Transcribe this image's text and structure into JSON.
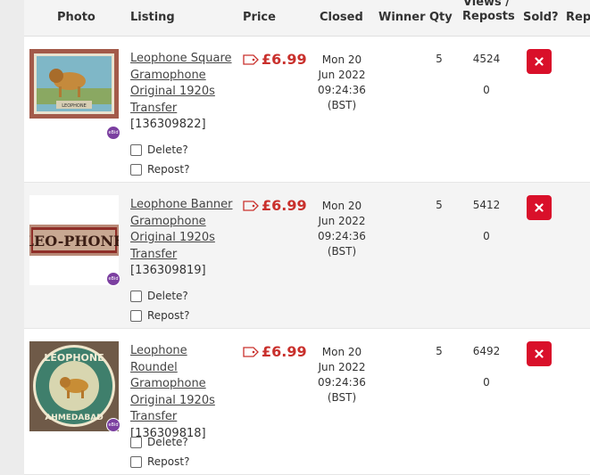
{
  "columns": {
    "photo": "Photo",
    "listing": "Listing",
    "price": "Price",
    "closed": "Closed",
    "winner": "Winner",
    "qty": "Qty",
    "views": "Views /",
    "reposts": "Reposts",
    "sold": "Sold?",
    "repost": "Repo"
  },
  "icons": {
    "price": "price-tag-icon",
    "sold": "close-x-icon",
    "badge": "ebid-badge-icon"
  },
  "colors": {
    "price": "#c9302c",
    "sold_button": "#d9102a",
    "badge": "#7b3fa0"
  },
  "rows": [
    {
      "title": "Leophone Square Gramophone Original 1920s Transfer",
      "id": "[136309822]",
      "delete_label": "Delete?",
      "repost_label": "Repost?",
      "price": "£6.99",
      "closed_day": "Mon 20",
      "closed_month": "Jun 2022",
      "closed_time": "09:24:36",
      "closed_tz": "(BST)",
      "winner": "",
      "qty": "5",
      "views": "4524",
      "reposts": "0",
      "image_text": "LEOPHONE",
      "badge_text": "eBid"
    },
    {
      "title": "Leophone Banner Gramophone Original 1920s Transfer",
      "id": "[136309819]",
      "delete_label": "Delete?",
      "repost_label": "Repost?",
      "price": "£6.99",
      "closed_day": "Mon 20",
      "closed_month": "Jun 2022",
      "closed_time": "09:24:36",
      "closed_tz": "(BST)",
      "winner": "",
      "qty": "5",
      "views": "5412",
      "reposts": "0",
      "image_text": "LEO-PHONE",
      "badge_text": "eBid"
    },
    {
      "title": "Leophone Roundel Gramophone Original 1920s Transfer",
      "id": "[136309818]",
      "delete_label": "Delete?",
      "repost_label": "Repost?",
      "price": "£6.99",
      "closed_day": "Mon 20",
      "closed_month": "Jun 2022",
      "closed_time": "09:24:36",
      "closed_tz": "(BST)",
      "winner": "",
      "qty": "5",
      "views": "6492",
      "reposts": "0",
      "image_text_top": "LEOPHONE",
      "image_text_bottom": "AHMEDABAD",
      "badge_text": "eBid"
    }
  ]
}
